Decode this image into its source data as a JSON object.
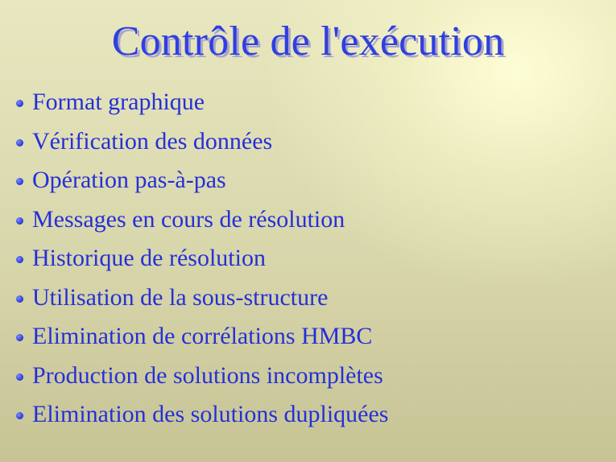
{
  "slide": {
    "title": "Contrôle de l'exécution",
    "bullets": [
      "Format graphique",
      "Vérification des données",
      "Opération pas-à-pas",
      "Messages en cours de résolution",
      "Historique de résolution",
      "Utilisation de la sous-structure",
      "Elimination de corrélations HMBC",
      "Production de solutions incomplètes",
      "Elimination des solutions dupliquées"
    ]
  },
  "colors": {
    "title": "#2f3fe0",
    "bullet_text": "#2530d8",
    "background": "#dedcb2"
  }
}
